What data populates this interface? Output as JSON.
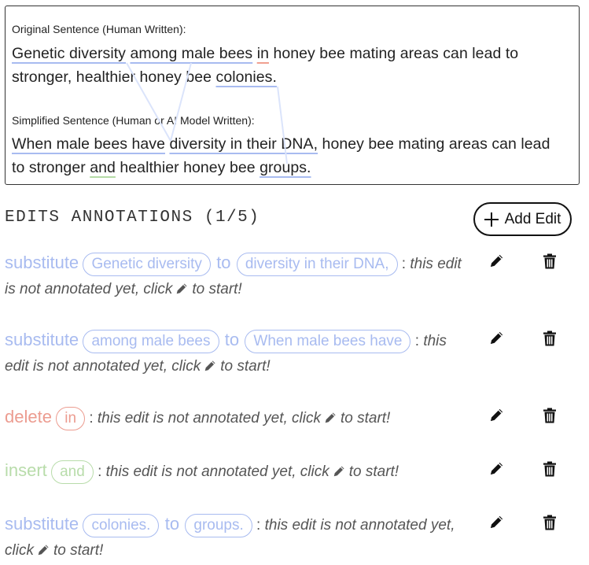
{
  "original": {
    "label": "Original Sentence (Human Written):",
    "line1": [
      {
        "t": "Genetic diversity",
        "u": "blue"
      },
      {
        "t": " ",
        "u": ""
      },
      {
        "t": "among male bees",
        "u": "blue"
      },
      {
        "t": " ",
        "u": ""
      },
      {
        "t": "in",
        "u": "red"
      },
      {
        "t": " honey bee mating areas can lead to",
        "u": ""
      }
    ],
    "line2": [
      {
        "t": "stronger, healthier honey bee ",
        "u": ""
      },
      {
        "t": "colonies.",
        "u": "blue"
      }
    ]
  },
  "simplified": {
    "label": "Simplified Sentence (Human or AI Model Written):",
    "line1": [
      {
        "t": "When male bees have",
        "u": "blue"
      },
      {
        "t": " ",
        "u": ""
      },
      {
        "t": "diversity in their DNA,",
        "u": "blue"
      },
      {
        "t": " honey bee mating areas can lead",
        "u": ""
      }
    ],
    "line2": [
      {
        "t": "to stronger ",
        "u": ""
      },
      {
        "t": "and",
        "u": "green"
      },
      {
        "t": " healthier honey bee ",
        "u": ""
      },
      {
        "t": "groups.",
        "u": "blue"
      }
    ]
  },
  "header": {
    "title": "EDITS ANNOTATIONS (1/5)",
    "add_edit_label": "Add Edit"
  },
  "edits": [
    {
      "op": "substitute",
      "kind": "sub",
      "from": "Genetic diversity",
      "to": "diversity in their DNA,",
      "note_pre": "this edit is not annotated yet, click",
      "note_post": "to start!"
    },
    {
      "op": "substitute",
      "kind": "sub",
      "from": "among male bees",
      "to": "When male bees have",
      "note_pre": "this edit is not annotated yet, click",
      "note_post": "to start!"
    },
    {
      "op": "delete",
      "kind": "del",
      "from": "in",
      "to": "",
      "note_pre": "this edit is not annotated yet, click",
      "note_post": "to start!"
    },
    {
      "op": "insert",
      "kind": "ins",
      "from": "and",
      "to": "",
      "note_pre": "this edit is not annotated yet, click",
      "note_post": "to start!"
    },
    {
      "op": "substitute",
      "kind": "sub",
      "from": "colonies.",
      "to": "groups.",
      "note_pre": "this edit is not annotated yet, click",
      "note_post": "to start!"
    }
  ],
  "connector_word": "to",
  "colors": {
    "substitute": "#a8bbf0",
    "delete": "#ec9c90",
    "insert": "#b8dcaa"
  }
}
